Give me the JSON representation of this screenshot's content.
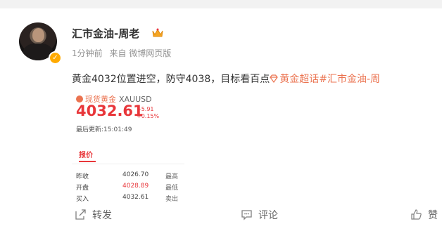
{
  "post": {
    "username": "汇市金油-周老",
    "meta": {
      "time": "1分钟前",
      "source": "来自 微博网页版"
    },
    "text": "黄金4032位置进空，防守4038，目标看百点",
    "topic": "黄金超话",
    "topic_tag": "#汇市金油-周",
    "quote": {
      "header_label": "现货黄金",
      "symbol": "XAUUSD",
      "price": "4032.61",
      "change_abs": "+5.91",
      "change_pct": "+0.15%",
      "updated": "最后更新:15:01:49",
      "tab_label": "报价",
      "rows": [
        {
          "label": "昨收",
          "value": "4026.70",
          "label2": "最高"
        },
        {
          "label": "开盘",
          "value": "4028.89",
          "label2": "最低"
        },
        {
          "label": "买入",
          "value": "4032.61",
          "label2": "卖出"
        }
      ]
    },
    "actions": {
      "forward": "转发",
      "comment": "评论",
      "like": "赞"
    }
  },
  "colors": {
    "accent": "#eb7350",
    "price_red": "#e8363a",
    "verified": "#ffaa00"
  }
}
